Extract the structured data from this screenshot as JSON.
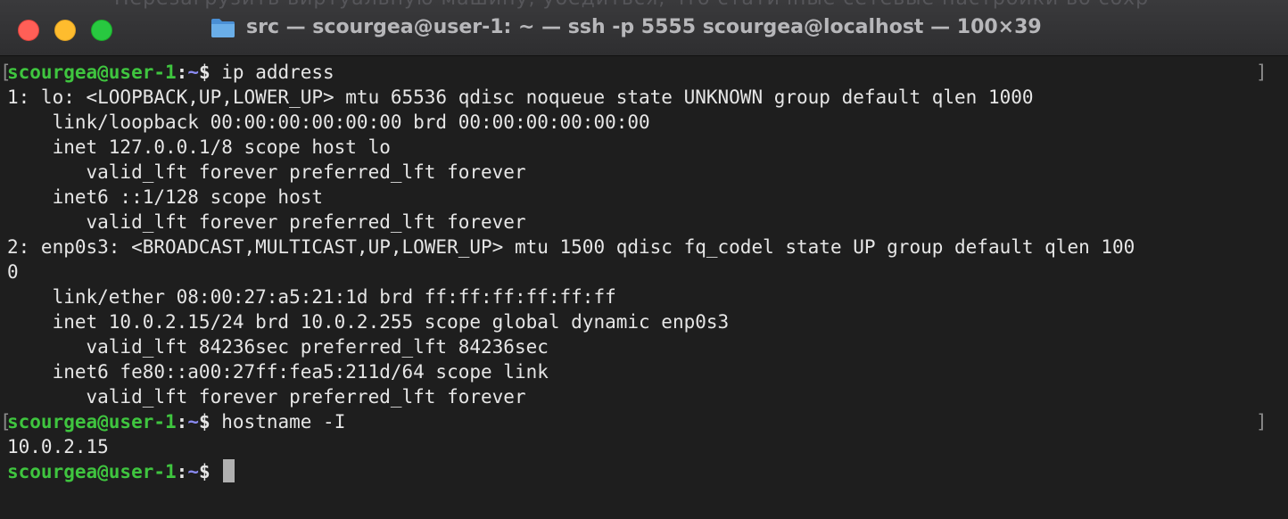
{
  "window": {
    "title": "src — scourgea@user-1: ~ — ssh -p 5555 scourgea@localhost — 100×39",
    "background_text": "Перезагрузить виртуальную машину, убедиться, что статичные сетевые настройки во сохр"
  },
  "terminal": {
    "prompt": {
      "user_host": "scourgea@user-1",
      "colon": ":",
      "dir": "~",
      "symbol": "$ "
    },
    "cmd1": "ip address",
    "out1": [
      "1: lo: <LOOPBACK,UP,LOWER_UP> mtu 65536 qdisc noqueue state UNKNOWN group default qlen 1000",
      "    link/loopback 00:00:00:00:00:00 brd 00:00:00:00:00:00",
      "    inet 127.0.0.1/8 scope host lo",
      "       valid_lft forever preferred_lft forever",
      "    inet6 ::1/128 scope host",
      "       valid_lft forever preferred_lft forever",
      "2: enp0s3: <BROADCAST,MULTICAST,UP,LOWER_UP> mtu 1500 qdisc fq_codel state UP group default qlen 100",
      "0",
      "    link/ether 08:00:27:a5:21:1d brd ff:ff:ff:ff:ff:ff",
      "    inet 10.0.2.15/24 brd 10.0.2.255 scope global dynamic enp0s3",
      "       valid_lft 84236sec preferred_lft 84236sec",
      "    inet6 fe80::a00:27ff:fea5:211d/64 scope link",
      "       valid_lft forever preferred_lft forever"
    ],
    "cmd2": "hostname -I",
    "out2": [
      "10.0.2.15"
    ],
    "mark_left": "[",
    "mark_right": "]"
  },
  "colors": {
    "prompt_user": "#3fc53f",
    "prompt_dir": "#8a8af0",
    "background": "#1e1e1e",
    "text": "#e6e6e6"
  }
}
